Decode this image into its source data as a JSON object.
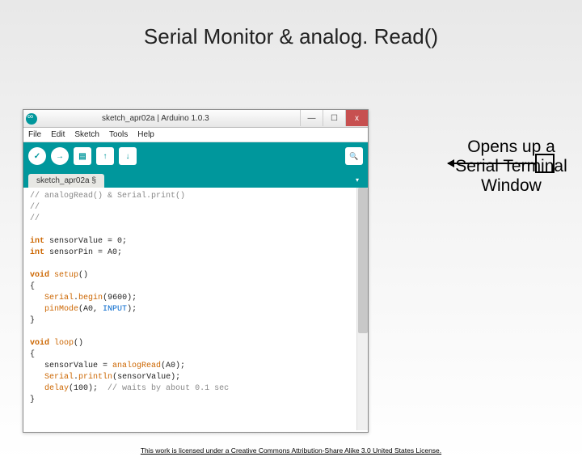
{
  "slide": {
    "title": "Serial Monitor & analog. Read()"
  },
  "ide": {
    "titlebar": "sketch_apr02a | Arduino 1.0.3",
    "min": "—",
    "max": "☐",
    "close": "x",
    "menus": {
      "file": "File",
      "edit": "Edit",
      "sketch": "Sketch",
      "tools": "Tools",
      "help": "Help"
    },
    "toolbar": {
      "verify": "✓",
      "upload": "→",
      "new": "▤",
      "open": "↑",
      "save": "↓",
      "serial": "🔍"
    },
    "tab": "sketch_apr02a §",
    "tab_caret": "▾"
  },
  "code": {
    "c1": "// analogRead() & Serial.print()",
    "c2": "//",
    "c3": "//",
    "l4a": "int",
    "l4b": " sensorValue = 0;",
    "l5a": "int",
    "l5b": " sensorPin = A0;",
    "l6a": "void ",
    "l6b": "setup",
    "l6c": "()",
    "l7": "{",
    "l8a": "   ",
    "l8b": "Serial",
    "l8c": ".",
    "l8d": "begin",
    "l8e": "(9600);",
    "l9a": "   ",
    "l9b": "pinMode",
    "l9c": "(A0, ",
    "l9d": "INPUT",
    "l9e": ");",
    "l10": "}",
    "l11a": "void ",
    "l11b": "loop",
    "l11c": "()",
    "l12": "{",
    "l13a": "   sensorValue = ",
    "l13b": "analogRead",
    "l13c": "(A0);",
    "l14a": "   ",
    "l14b": "Serial",
    "l14c": ".",
    "l14d": "println",
    "l14e": "(sensorValue);",
    "l15a": "   ",
    "l15b": "delay",
    "l15c": "(100);  ",
    "l15d": "// waits by about 0.1 sec",
    "l16": "}"
  },
  "callout": {
    "text": "Opens up a Serial Terminal Window"
  },
  "footer": {
    "license": "This work is licensed under a Creative Commons Attribution-Share Alike 3.0 United States License."
  },
  "chart_data": null
}
